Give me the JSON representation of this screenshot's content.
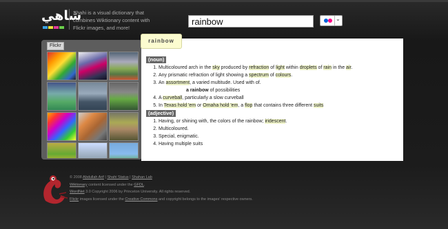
{
  "colors": {
    "bar1": "#3aa0e0",
    "bar2": "#e8e23a",
    "bar3": "#e03a9a",
    "bar4": "#6ad04a",
    "flickr_blue": "#0063dc",
    "flickr_pink": "#ff0084",
    "highlight": "#eef3c8"
  },
  "header": {
    "logo_text": "شاهي",
    "tagline": "Shahi is a visual dictionary that combines Wiktionary content with Flickr images, and more!",
    "search_value": "rainbow",
    "source_icon": "flickr-icon"
  },
  "gallery": {
    "tab_label": "Flickr",
    "thumb_count": 15
  },
  "word": "rainbow",
  "noun": {
    "label": "(noun)",
    "d1": {
      "t1": "Multicoloured arch in the ",
      "l1": "sky",
      "t2": " produced by ",
      "l2": "refraction",
      "t3": " of ",
      "l3": "light",
      "t4": " within ",
      "l4": "droplets",
      "t5": " of ",
      "l5": "rain",
      "t6": " in the ",
      "l6": "air",
      "t7": "."
    },
    "d2": {
      "t1": "Any prismatic refraction of light showing a ",
      "l1": "spectrum",
      "t2": " of ",
      "l2": "colours",
      "t3": "."
    },
    "d3": {
      "t1": "An ",
      "l1": "assortment",
      "t2": ", a varied multitude. Used with of."
    },
    "d3_example": {
      "bold": "a rainbow",
      "rest": " of possibilities"
    },
    "d4": {
      "t1": "A ",
      "l1": "curveball",
      "t2": ", particularly a slow curveball"
    },
    "d5": {
      "t1": "In ",
      "l1": "Texas hold 'em",
      "t2": " or ",
      "l2": "Omaha hold 'em",
      "t3": ", a ",
      "l3": "flop",
      "t4": " that contains three different ",
      "l4": "suits"
    }
  },
  "adjective": {
    "label": "(adjective)",
    "d1": {
      "t1": "Having, or shining with, the colors of the rainbow; ",
      "l1": "iridescent",
      "t2": "."
    },
    "d2": "Multicoloured.",
    "d3": "Special, enigmatic.",
    "d4": "Having multiple suits"
  },
  "footer": {
    "l1": {
      "t1": "© 2008 ",
      "a1": "Abdullah Arif",
      "t2": " | ",
      "a2": "Shahi Status",
      "t3": " | ",
      "a3": "Shahan Lab"
    },
    "l2": {
      "a1": "Wiktionary",
      "t1": " content licensed under the ",
      "a2": "GFDL",
      "t2": "."
    },
    "l3": {
      "a1": "WordNet",
      "t1": " 3.0 Copyright 2006 by Princeton University. All rights reserved."
    },
    "l4": {
      "a1": "Flickr",
      "t1": " images licensed under the ",
      "a2": "Creative Commons",
      "t2": " and copyright belongs to the images' respective owners."
    }
  }
}
